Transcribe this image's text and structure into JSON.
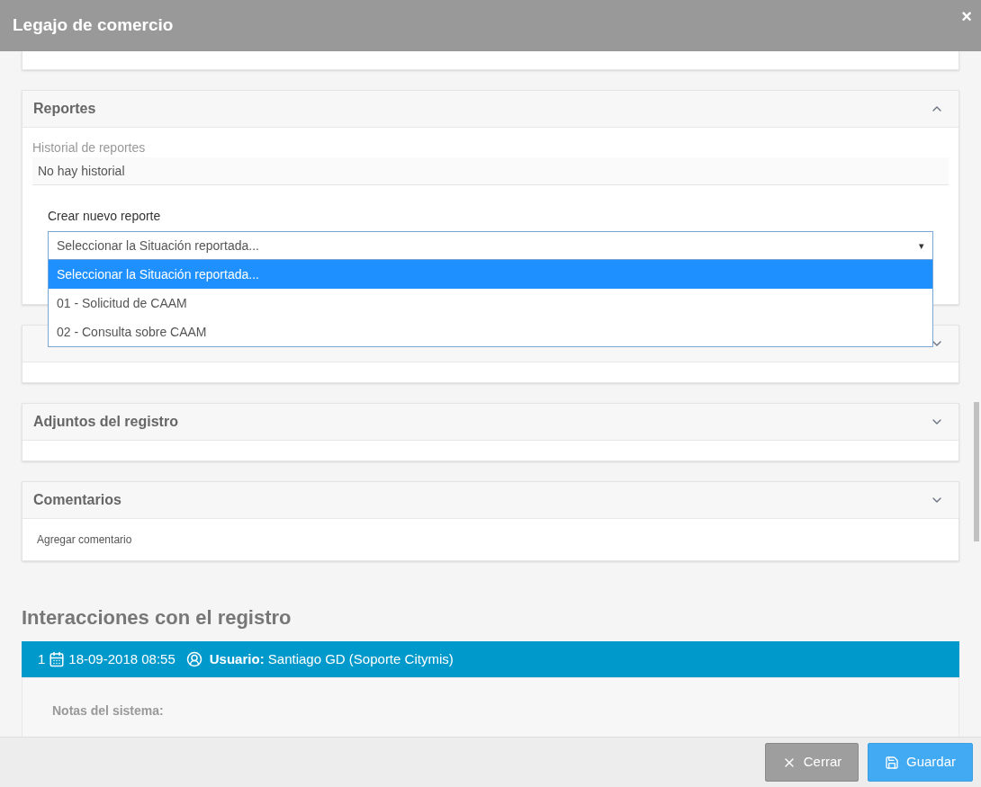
{
  "window": {
    "title": "Legajo de comercio",
    "close": "×"
  },
  "sections": [
    {
      "kind": "reports",
      "title": "Reportes",
      "expanded": true,
      "history_label": "Historial de reportes",
      "history_empty": "No hay historial",
      "new_label": "Crear nuevo reporte",
      "select": {
        "value": "Seleccionar la Situación reportada...",
        "open": true,
        "caret": "▾",
        "options": [
          {
            "label": "Seleccionar la Situación reportada...",
            "selected": true
          },
          {
            "label": "01 - Solicitud de CAAM",
            "selected": false
          },
          {
            "label": "02 - Consulta sobre CAAM",
            "selected": false
          }
        ]
      }
    },
    {
      "kind": "plain",
      "expanded": false
    },
    {
      "kind": "plain",
      "title": "Adjuntos del registro",
      "expanded": false
    },
    {
      "kind": "comments",
      "title": "Comentarios",
      "expanded": false,
      "link": "Agregar comentario"
    }
  ],
  "interactions": {
    "title": "Interacciones con el registro",
    "items": [
      {
        "number": "1",
        "date": "18-09-2018 08:55",
        "user_label": "Usuario:",
        "user": "Santiago GD (Soporte Citymis)",
        "notes_label": "Notas del sistema:"
      }
    ]
  },
  "footer": {
    "buttons": [
      {
        "kind": "close",
        "label": "Cerrar"
      },
      {
        "kind": "save",
        "label": "Guardar"
      }
    ]
  }
}
